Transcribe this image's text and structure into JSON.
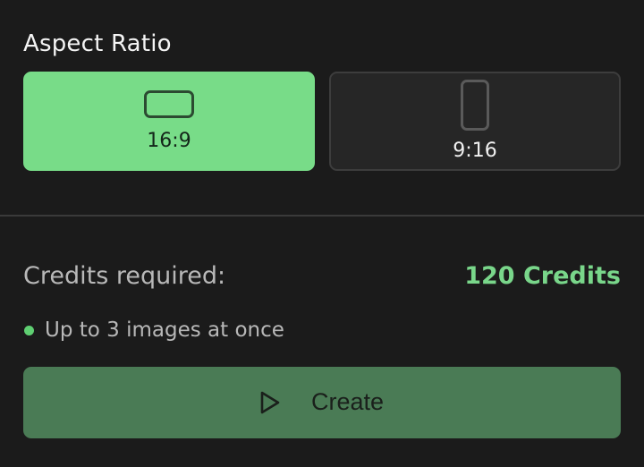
{
  "aspect_ratio": {
    "title": "Aspect Ratio",
    "options": [
      {
        "label": "16:9",
        "icon": "landscape-frame-icon",
        "selected": true
      },
      {
        "label": "9:16",
        "icon": "portrait-frame-icon",
        "selected": false
      }
    ]
  },
  "credits": {
    "label": "Credits required:",
    "value": "120 Credits"
  },
  "info": {
    "text": "Up to 3 images at once"
  },
  "actions": {
    "create_label": "Create",
    "create_icon": "play-icon"
  },
  "colors": {
    "accent_green": "#78dc88",
    "button_green": "#4a7b55",
    "background": "#1b1b1b",
    "credits_value": "#79d68a"
  }
}
